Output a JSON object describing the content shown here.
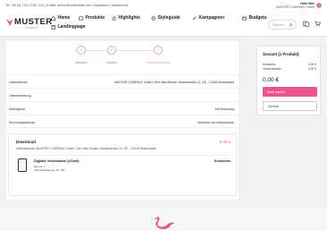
{
  "topbar": {
    "contact": "Tel. +49 (0) 7 111 / 138 - 120  |  ✉ Mail: service@musterfirab.com  |  Impressum  |  Datenschutz",
    "user_name": "Hallo Max",
    "user_company": "MUSTER COMPANY GmbH"
  },
  "brand": {
    "name": "MUSTER",
    "sub": "COMPANY",
    "accent": "#e8568b"
  },
  "nav": {
    "home": "Home",
    "produkte": "Produkte",
    "highlights": "Highlights",
    "styleguide": "Styleguide",
    "kampagnen": "Kampagnen",
    "budgets": "Budgets",
    "landingpage": "Landingpage"
  },
  "search": {
    "placeholder": "Suchen"
  },
  "checkout": {
    "steps": [
      {
        "num": "1",
        "label": "Adressen"
      },
      {
        "num": "2",
        "label": "Versand"
      },
      {
        "num": "3",
        "label": "Zusammenfassung"
      }
    ],
    "rows": [
      {
        "key": "Lieferadresse",
        "value": "MUSTER COMPANY GmbH, Herr Max Muster, Musterstraße 12, DE - 12345 Musterstadt"
      },
      {
        "key": "Lieferanweisung",
        "value": ""
      },
      {
        "key": "Zahlungsart",
        "value": "Auf Rechnung"
      },
      {
        "key": "Rechnungsadresse",
        "value": "Identisch mit Lieferadresse"
      }
    ],
    "download": {
      "title": "Download",
      "price": "0,00 €",
      "address": "Lieferadresse: MUSTER COMPANY GmbH, Herr Max Muster, Musterstraße 12, DE - 12345 Musterstadt",
      "product_name": "Digitale Visitenkarte (vCard)",
      "product_price": "Kostenlos",
      "meta1": "Menge:  1",
      "meta2": "Individualisierung: ID:  185"
    }
  },
  "summary": {
    "title": "Gesamt (1 Produkt)",
    "lines": [
      {
        "label": "Nettopreis",
        "value": "0,00 €"
      },
      {
        "label": "Versandkosten",
        "value": "0,00 €"
      }
    ],
    "total": "0,00 €",
    "buy_label": "Jetzt kaufen",
    "back_label": "Zurück"
  }
}
